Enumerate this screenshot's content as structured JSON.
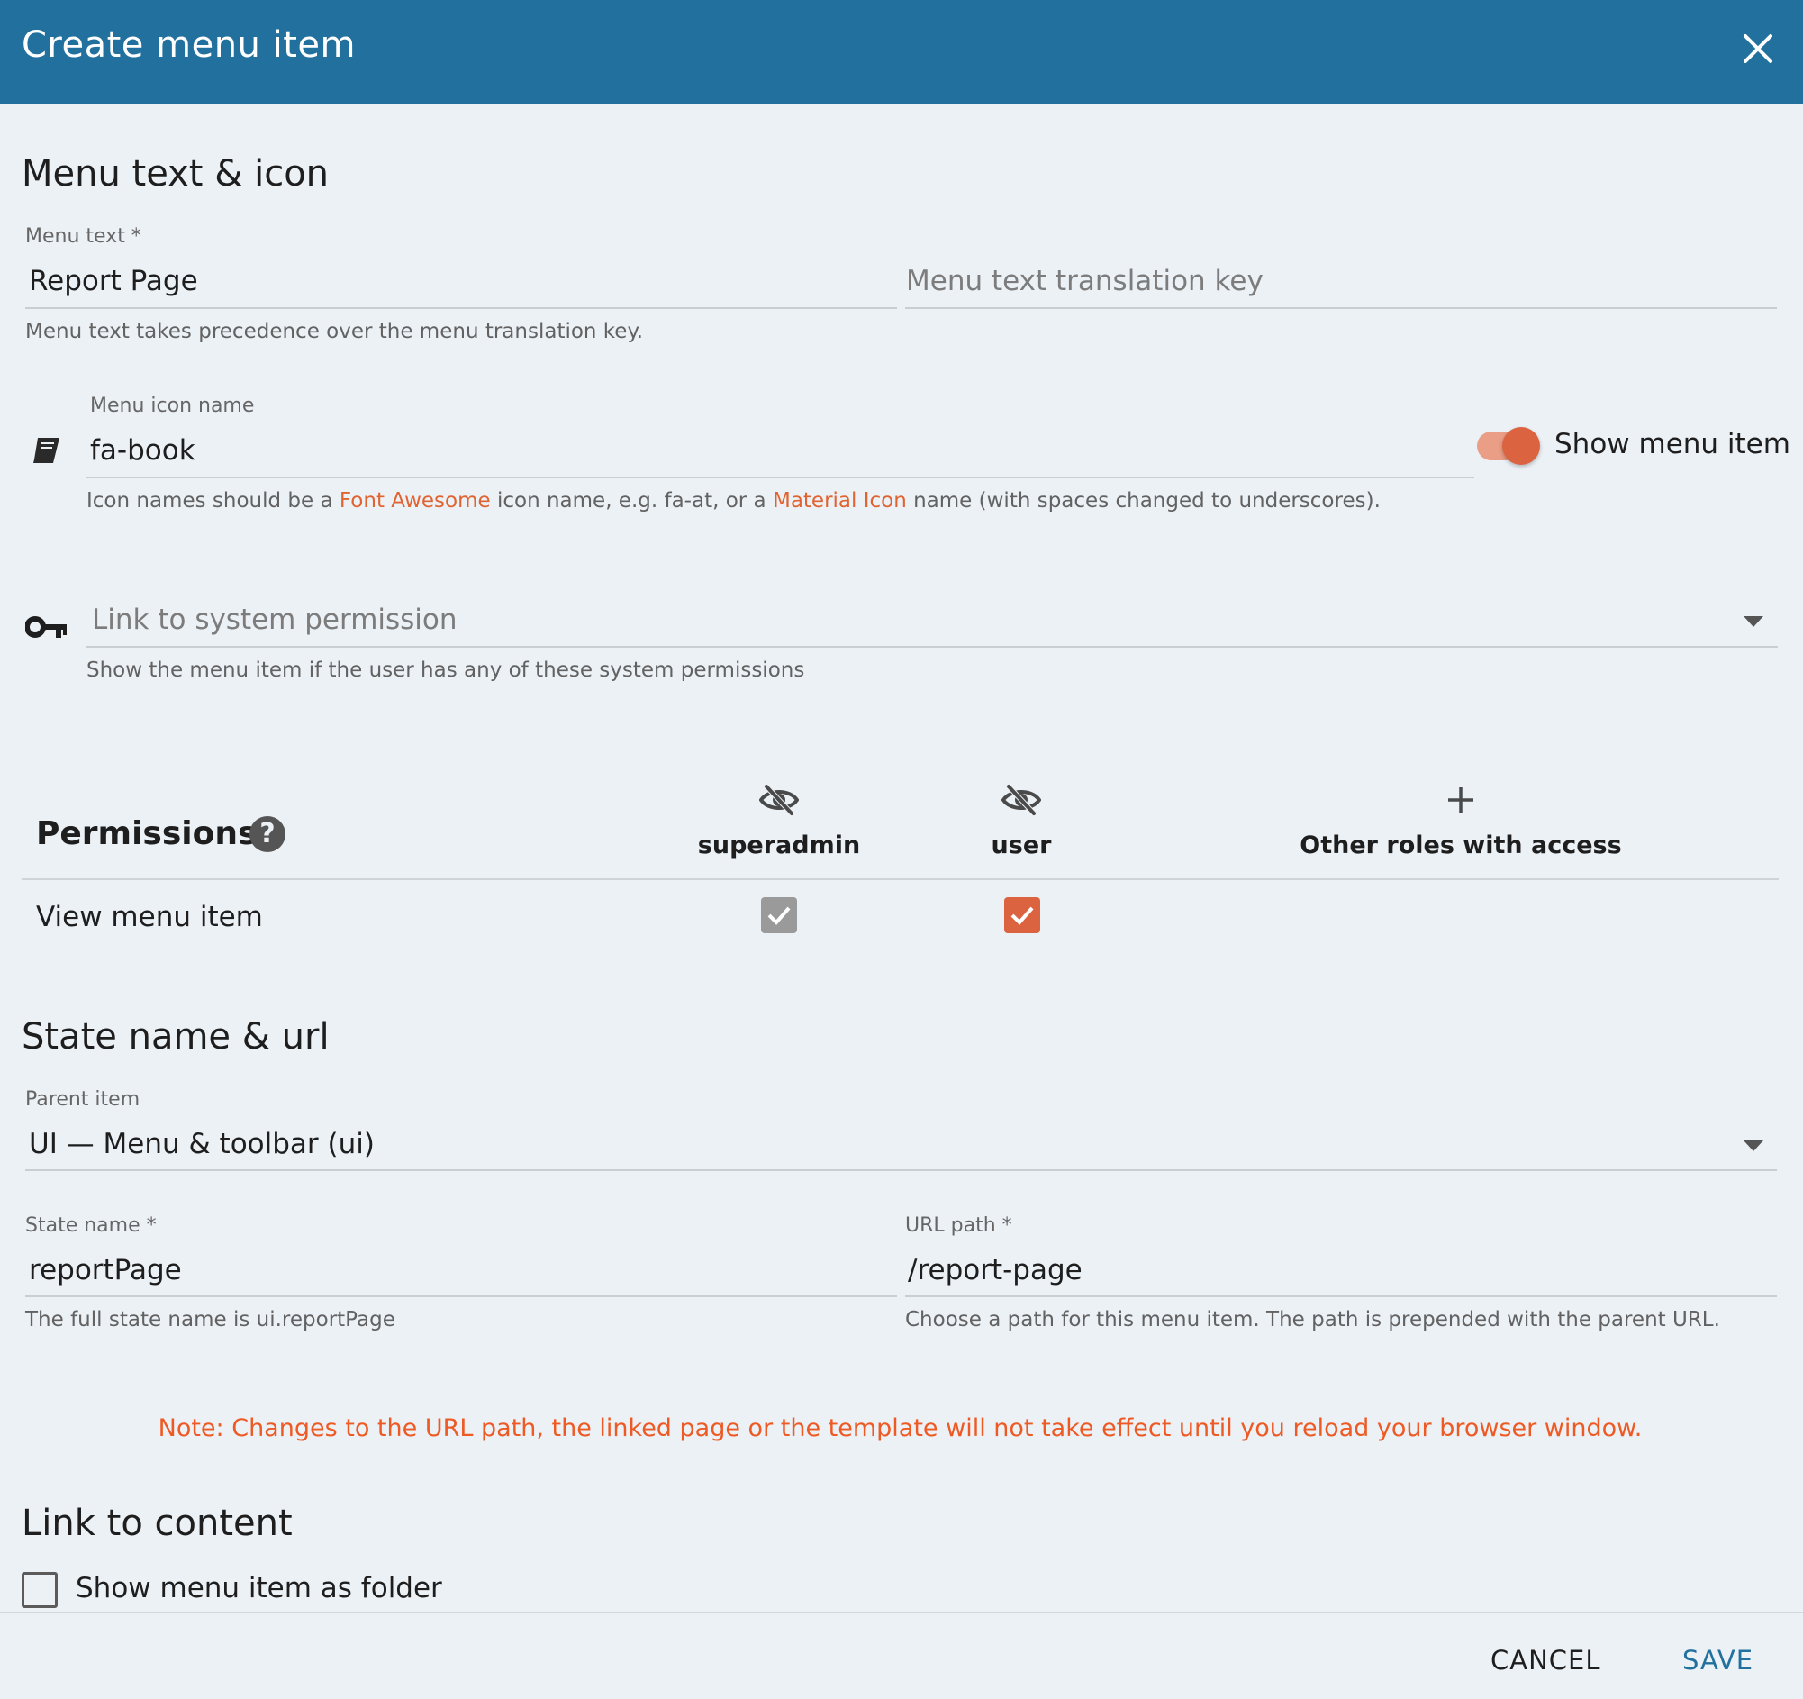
{
  "dialog": {
    "title": "Create menu item",
    "close_icon": "close-icon"
  },
  "menu_text_section": {
    "heading": "Menu text & icon",
    "menu_text": {
      "label": "Menu text *",
      "value": "Report Page"
    },
    "translation_key": {
      "placeholder": "Menu text translation key",
      "value": ""
    },
    "menu_text_hint": "Menu text takes precedence over the menu translation key.",
    "icon_name": {
      "label": "Menu icon name",
      "value": "fa-book",
      "icon": "book-icon"
    },
    "icon_hint": {
      "part1": "Icon names should be a ",
      "link1": "Font Awesome",
      "part2": " icon name, e.g. fa-at, or a ",
      "link2": "Material Icon",
      "part3": " name (with spaces changed to underscores)."
    },
    "show_menu_item": {
      "label": "Show menu item",
      "on": true
    },
    "system_permission": {
      "placeholder": "Link to system permission",
      "icon": "key-icon",
      "hint": "Show the menu item if the user has any of these system permissions"
    }
  },
  "permissions": {
    "title": "Permissions",
    "help_icon": "help-icon",
    "columns": [
      {
        "label": "superadmin",
        "icon": "eye-off-icon"
      },
      {
        "label": "user",
        "icon": "eye-off-icon"
      },
      {
        "label": "Other roles with access",
        "icon": "plus-icon"
      }
    ],
    "rows": [
      {
        "label": "View menu item",
        "superadmin": true,
        "user": true
      }
    ]
  },
  "state_section": {
    "heading": "State name & url",
    "parent_item": {
      "label": "Parent item",
      "value": "UI — Menu & toolbar (ui)"
    },
    "state_name": {
      "label": "State name *",
      "value": "reportPage",
      "hint": "The full state name is ui.reportPage"
    },
    "url_path": {
      "label": "URL path *",
      "value": "/report-page",
      "hint": "Choose a path for this menu item. The path is prepended with the parent URL."
    },
    "note": "Note: Changes to the URL path, the linked page or the template will not take effect until you reload your browser window."
  },
  "content_section": {
    "heading": "Link to content",
    "folder_checkbox": {
      "label": "Show menu item as folder",
      "checked": false
    }
  },
  "footer": {
    "cancel_label": "CANCEL",
    "save_label": "SAVE"
  },
  "colors": {
    "header": "#22709e",
    "accent": "#dc6340",
    "primary_button": "#22709e",
    "background": "#ecf1f6"
  }
}
